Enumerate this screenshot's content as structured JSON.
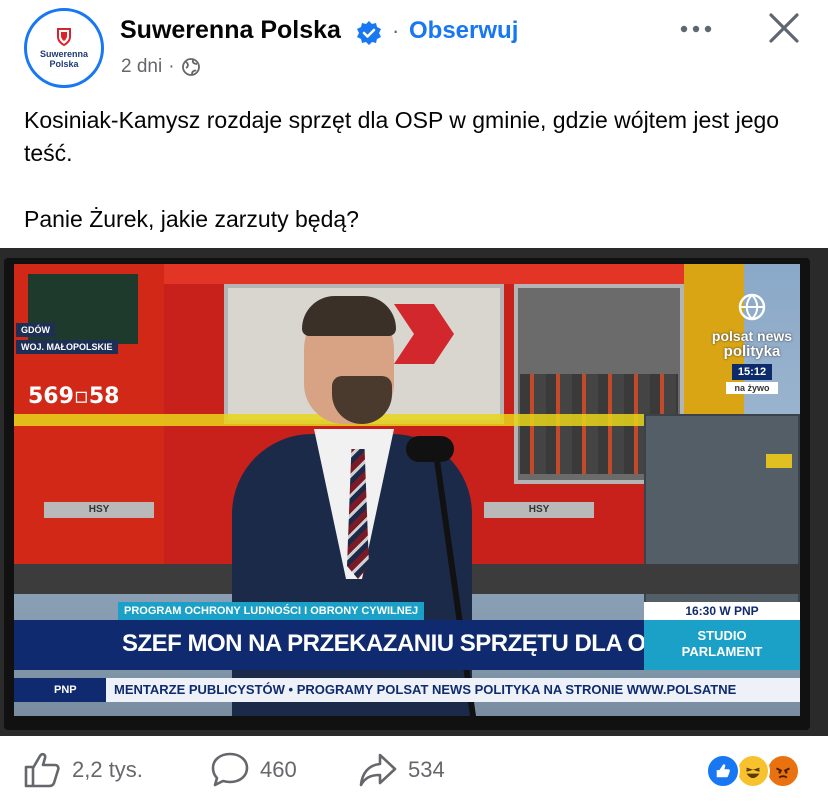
{
  "header": {
    "avatar_text": "Suwerenna Polska",
    "page_name": "Suwerenna Polska",
    "separator": "·",
    "follow_label": "Obserwuj",
    "timestamp": "2 dni",
    "meta_separator": "·",
    "icons": [
      "globe-icon",
      "verified-badge-icon",
      "more-icon",
      "close-icon"
    ]
  },
  "post": {
    "line1": "Kosiniak-Kamysz rozdaje sprzęt dla OSP w gminie, gdzie wójtem jest jego teść.",
    "line2": "Panie Żurek, jakie zarzuty będą?"
  },
  "image": {
    "location_top": "GDÓW",
    "location_bottom": "WOJ. MAŁOPOLSKIE",
    "unit_number": "569▫58",
    "hsy_label": "HSY",
    "channel_name": "polsat news",
    "channel_sub": "polityka",
    "channel_time": "15:12",
    "channel_live": "na żywo",
    "kicker": "PROGRAM OCHRONY LUDNOŚCI I OBRONY CYWILNEJ",
    "headline": "SZEF MON NA PRZEKAZANIU SPRZĘTU DLA OSP GDÓW",
    "next_time": "16:30 W PNP",
    "next_show_1": "STUDIO",
    "next_show_2": "PARLAMENT",
    "ticker_tag": "PNP",
    "ticker_text": "MENTARZE PUBLICYSTÓW  •  PROGRAMY POLSAT NEWS POLITYKA NA STRONIE WWW.POLSATNE"
  },
  "footer": {
    "likes": "2,2 tys.",
    "comments": "460",
    "shares": "534",
    "reactions": [
      "like",
      "haha",
      "angry"
    ]
  },
  "colors": {
    "accent": "#1877f2",
    "text_secondary": "#65676b",
    "tv_navy": "#0f2a6f",
    "tv_cyan": "#1ba0c7"
  }
}
